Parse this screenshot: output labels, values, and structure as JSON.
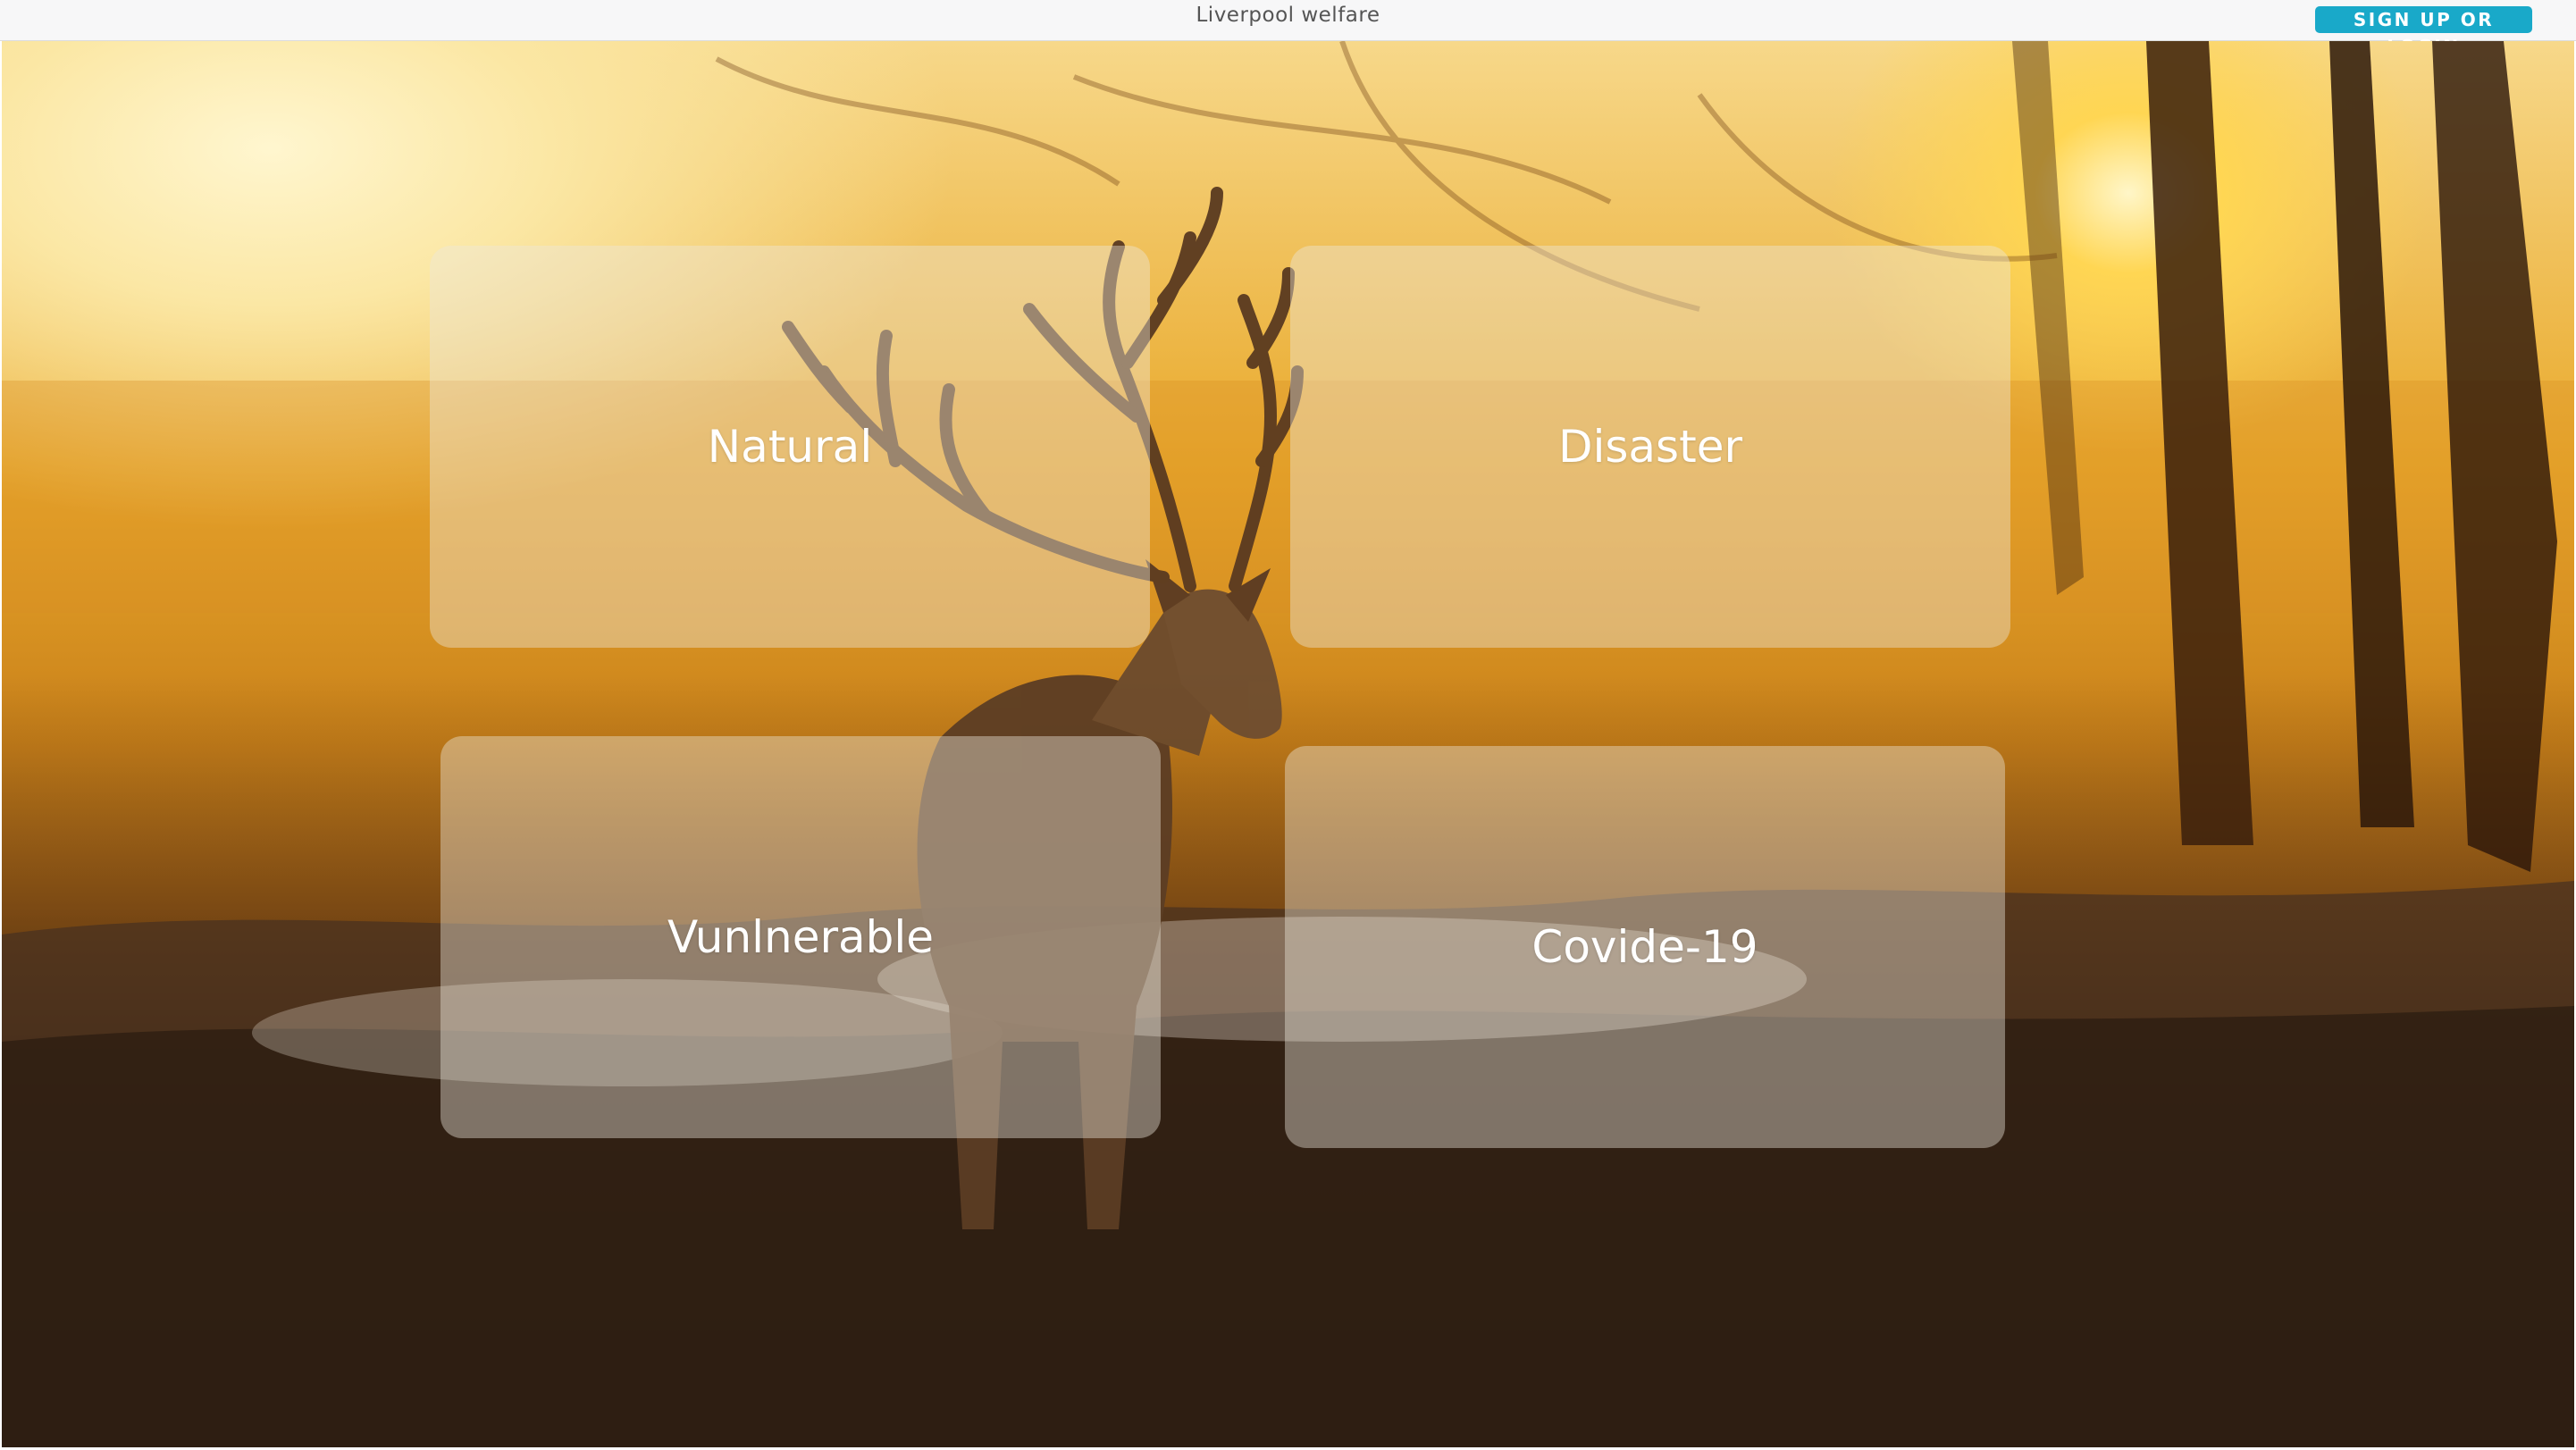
{
  "header": {
    "title": "Liverpool welfare",
    "signup_label": "SIGN UP OR LOGIN"
  },
  "hero": {
    "background": "sunrise-forest-deer-photo"
  },
  "cards": [
    {
      "label": "Natural"
    },
    {
      "label": "Disaster"
    },
    {
      "label": "Vunlnerable"
    },
    {
      "label": "Covide-19"
    }
  ],
  "colors": {
    "accent": "#19a9c9",
    "topbar_bg": "#f7f7f8",
    "card_text": "#ffffff"
  }
}
